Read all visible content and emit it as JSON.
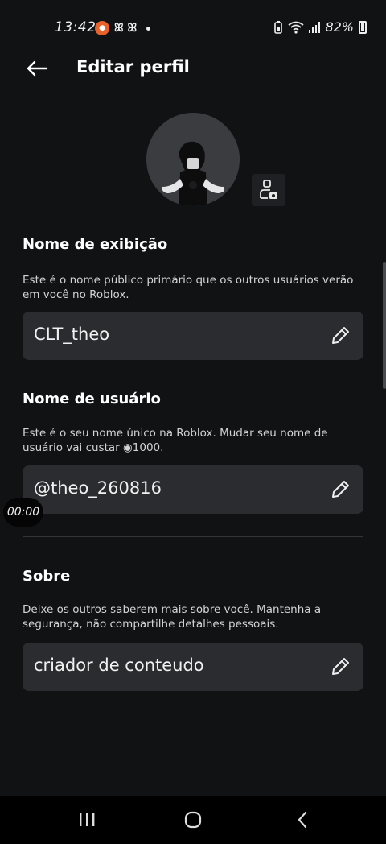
{
  "status_bar": {
    "time": "13:42",
    "battery": "82%",
    "notif_icon": "app-notification-icon",
    "capcut_glyph": "ꕤ ꕤ"
  },
  "header": {
    "title": "Editar perfil",
    "back_icon": "back-arrow-icon"
  },
  "display_name": {
    "title": "Nome de exibição",
    "description": "Este é o nome público primário que os outros usuários verão em você no Roblox.",
    "value": "CLT_theo"
  },
  "username": {
    "title": "Nome de usuário",
    "description": "Este é o seu nome único na Roblox. Mudar seu nome de usuário vai custar ◉1000.",
    "value": "@theo_260816"
  },
  "about": {
    "title": "Sobre",
    "description": "Deixe os outros saberem mais sobre você. Mantenha a segurança, não compartilhe detalhes pessoais.",
    "value": "criador de conteudo"
  },
  "overlay": {
    "timer": "00:00"
  },
  "colors": {
    "background": "#111214",
    "field": "#2b2c30",
    "text": "#ffffff",
    "muted_text": "#d2d3d6"
  }
}
